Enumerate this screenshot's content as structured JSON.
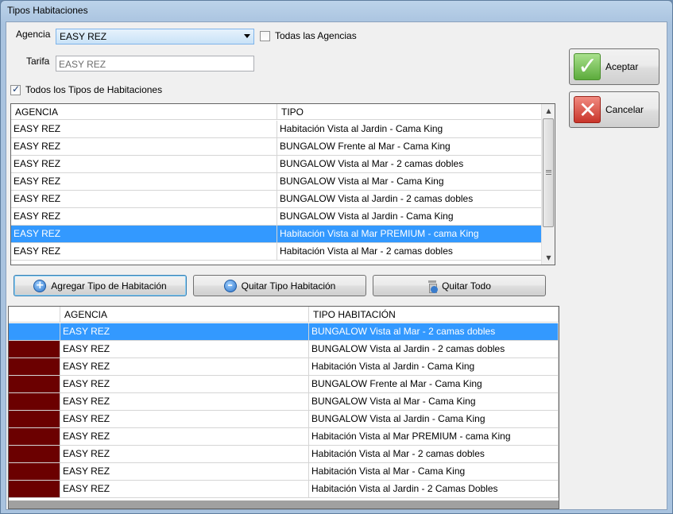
{
  "window": {
    "title": "Tipos Habitaciones"
  },
  "form": {
    "agencia_label": "Agencia",
    "agencia_value": "EASY REZ",
    "todas_agencias_label": "Todas las Agencias",
    "todas_agencias_checked": false,
    "tarifa_label": "Tarifa",
    "tarifa_value": "EASY REZ",
    "todos_tipos_label": "Todos los Tipos de Habitaciones",
    "todos_tipos_checked": true
  },
  "buttons": {
    "aceptar": "Aceptar",
    "cancelar": "Cancelar",
    "agregar": "Agregar Tipo de Habitación",
    "quitar": "Quitar Tipo Habitación",
    "quitar_todo": "Quitar Todo"
  },
  "grid_top": {
    "headers": [
      "AGENCIA",
      "TIPO"
    ],
    "selected_index": 6,
    "rows": [
      [
        "EASY REZ",
        "Habitación Vista al Jardin - Cama King"
      ],
      [
        "EASY REZ",
        "BUNGALOW Frente al Mar - Cama King"
      ],
      [
        "EASY REZ",
        "BUNGALOW Vista al Mar - 2 camas dobles"
      ],
      [
        "EASY REZ",
        "BUNGALOW Vista al Mar - Cama King"
      ],
      [
        "EASY REZ",
        "BUNGALOW Vista al Jardin - 2 camas dobles"
      ],
      [
        "EASY REZ",
        "BUNGALOW Vista al Jardin - Cama King"
      ],
      [
        "EASY REZ",
        "Habitación Vista al Mar PREMIUM - cama King"
      ],
      [
        "EASY REZ",
        "Habitación Vista al Mar - 2 camas dobles"
      ]
    ]
  },
  "grid_bottom": {
    "headers": [
      "",
      "AGENCIA",
      "TIPO HABITACIÓN"
    ],
    "selected_index": 0,
    "row_marker_color": "#6b0000",
    "rows": [
      [
        "EASY REZ",
        "BUNGALOW Vista al Mar - 2 camas dobles"
      ],
      [
        "EASY REZ",
        "BUNGALOW Vista al Jardin - 2 camas dobles"
      ],
      [
        "EASY REZ",
        "Habitación Vista al Jardin - Cama King"
      ],
      [
        "EASY REZ",
        "BUNGALOW Frente al Mar - Cama King"
      ],
      [
        "EASY REZ",
        "BUNGALOW Vista al Mar - Cama King"
      ],
      [
        "EASY REZ",
        "BUNGALOW Vista al Jardin - Cama King"
      ],
      [
        "EASY REZ",
        "Habitación Vista al Mar PREMIUM - cama King"
      ],
      [
        "EASY REZ",
        "Habitación Vista al Mar - 2 camas dobles"
      ],
      [
        "EASY REZ",
        "Habitación Vista al Mar - Cama King"
      ],
      [
        "EASY REZ",
        "Habitación Vista al Jardin - 2 Camas Dobles"
      ]
    ]
  },
  "colors": {
    "selection": "#3399ff",
    "marker": "#6b0000"
  },
  "icons": {
    "agregar": "add-circle-icon",
    "quitar": "remove-circle-icon",
    "quitar_todo": "trash-icon",
    "aceptar": "checkmark-icon",
    "cancelar": "x-icon"
  }
}
